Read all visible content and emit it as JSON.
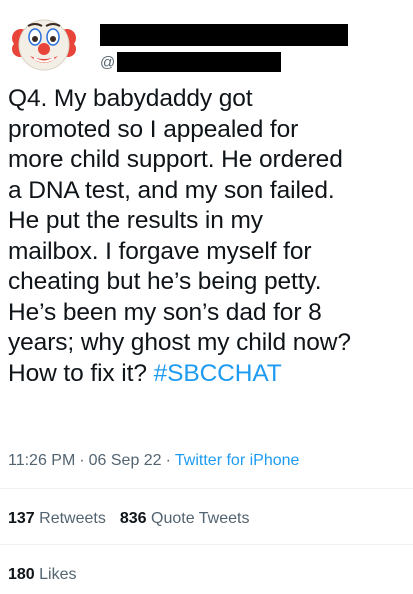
{
  "author": {
    "avatar_icon": "clown-face-icon",
    "handle_prefix": "@"
  },
  "tweet": {
    "text_lines": [
      "Q4. My babydaddy got",
      "promoted so I appealed for",
      "more child support. He ordered",
      "a DNA test, and my son failed.",
      "He put the results in my",
      "mailbox. I forgave myself for",
      "cheating but he’s being petty.",
      "He’s been my son’s dad for 8",
      "years; why ghost my child now?",
      "How to fix it? "
    ],
    "hashtag": "#SBCCHAT"
  },
  "meta": {
    "time": "11:26 PM",
    "date": "06 Sep 22",
    "source": "Twitter for iPhone"
  },
  "stats": {
    "retweets_count": "137",
    "retweets_label": "Retweets",
    "quotes_count": "836",
    "quotes_label": "Quote Tweets",
    "likes_count": "180",
    "likes_label": "Likes"
  },
  "colors": {
    "link": "#1d9bf0",
    "secondary_text": "#536471",
    "primary_text": "#0f1419"
  }
}
